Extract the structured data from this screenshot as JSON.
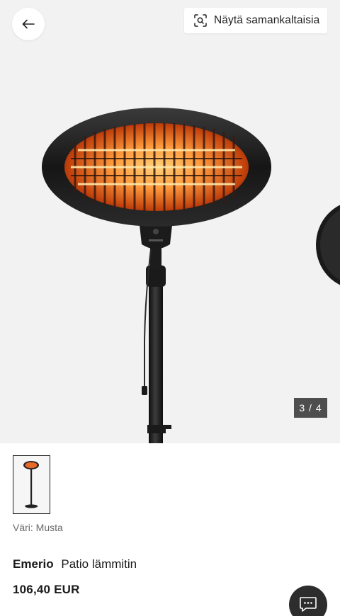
{
  "header": {
    "back_icon": "arrow-left-icon",
    "similar_button_label": "Näytä samankaltaisia",
    "similar_icon": "visual-search-icon"
  },
  "gallery": {
    "counter": "3 / 4",
    "background_color": "#f2f2f2"
  },
  "product": {
    "color_label": "Väri: Musta",
    "brand": "Emerio",
    "name": "Patio lämmitin",
    "price": "106,40 EUR"
  },
  "chat": {
    "icon": "chat-bubble-icon"
  }
}
